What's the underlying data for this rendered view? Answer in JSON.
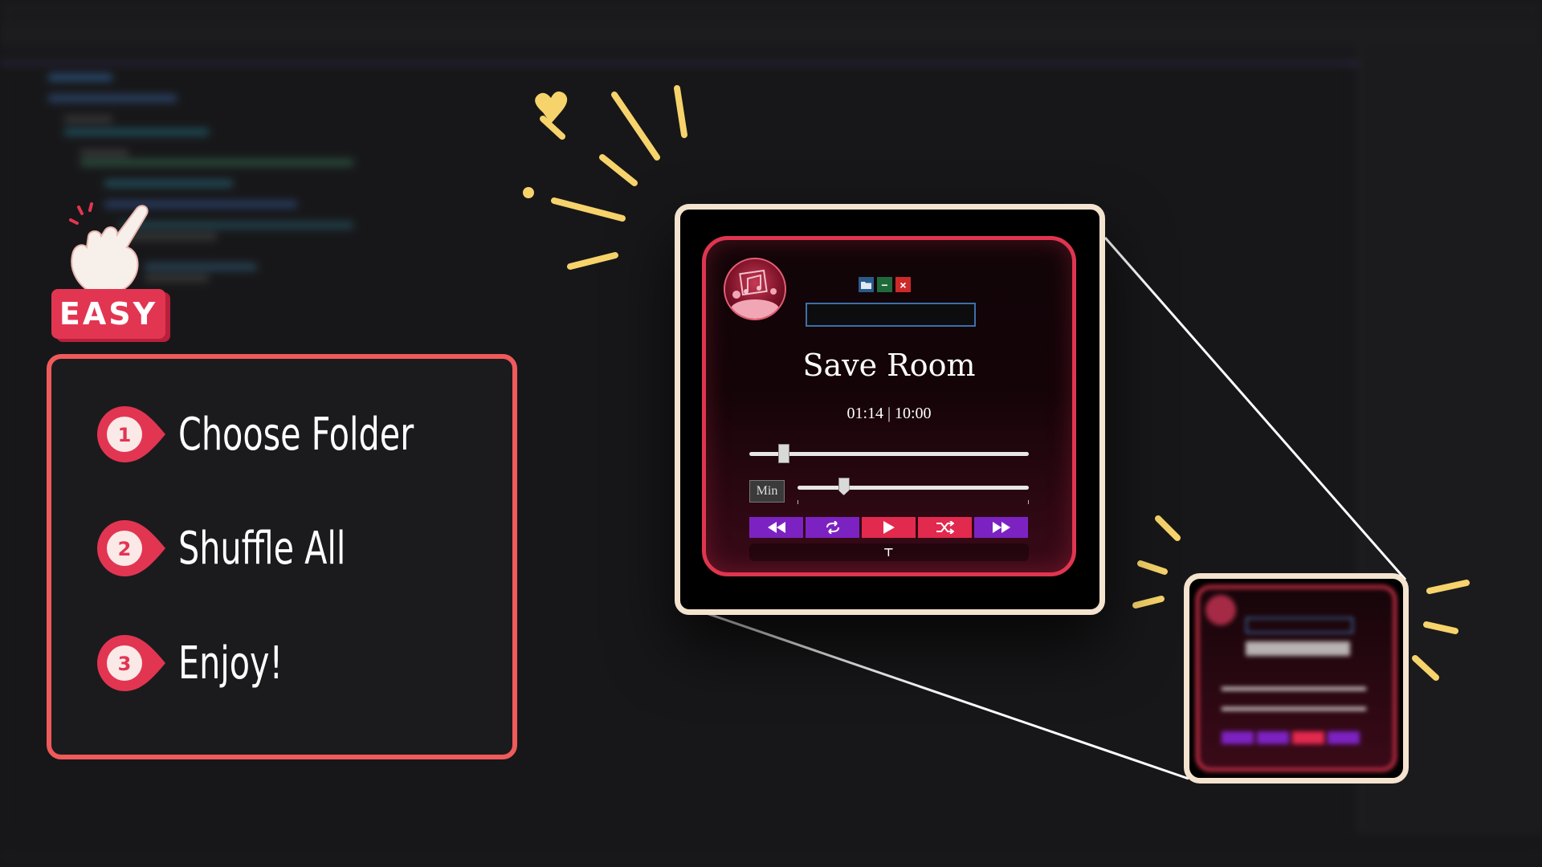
{
  "badge": {
    "label": "EASY"
  },
  "steps": [
    {
      "number": "1",
      "label": "Choose Folder"
    },
    {
      "number": "2",
      "label": "Shuffle All"
    },
    {
      "number": "3",
      "label": "Enjoy!"
    }
  ],
  "player": {
    "title": "Save Room",
    "time": "01:14 | 10:00",
    "elapsed_fraction": 0.123,
    "volume_fraction": 0.2,
    "min_label": "Min",
    "folder_path": "",
    "window_controls": {
      "folder": "folder-icon",
      "minimize": "−",
      "close": "×"
    },
    "controls": [
      "rewind-icon",
      "repeat-icon",
      "play-icon",
      "shuffle-icon",
      "fast-forward-icon"
    ],
    "handle_glyph": "⊤"
  },
  "colors": {
    "accent_red": "#e23552",
    "frame_border": "#f05a5a",
    "control_purple": "#7d22c2",
    "zoom_frame": "#f3e3cf",
    "sparkle": "#f6d36b"
  }
}
